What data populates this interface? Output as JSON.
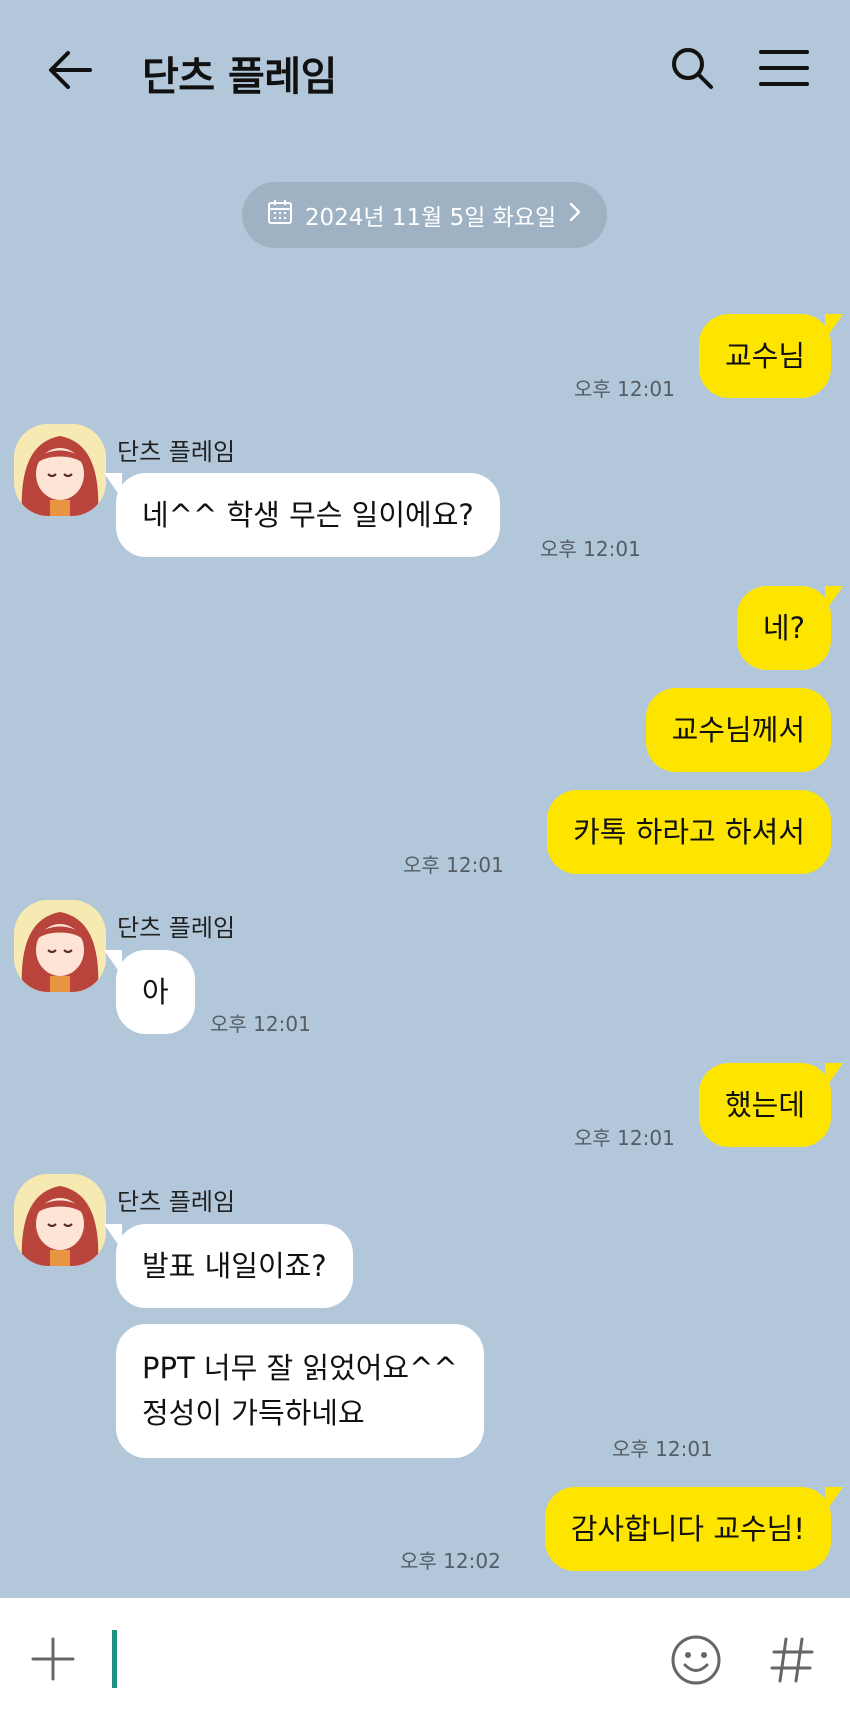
{
  "header": {
    "title": "단츠 플레임",
    "back_icon": "arrow-left-icon",
    "search_icon": "search-icon",
    "menu_icon": "hamburger-menu-icon"
  },
  "date_divider": {
    "text": "2024년 11월 5일 화요일",
    "icon": "calendar-icon",
    "chevron": "chevron-right-icon"
  },
  "contact": {
    "name": "단츠 플레임",
    "avatar": "anime-girl-avatar"
  },
  "messages": [
    {
      "from": "me",
      "text": "교수님",
      "time": "오후 12:01"
    },
    {
      "from": "other",
      "text": "네^^ 학생 무슨 일이에요?",
      "time": "오후 12:01"
    },
    {
      "from": "me",
      "text": "네?"
    },
    {
      "from": "me",
      "text": "교수님께서"
    },
    {
      "from": "me",
      "text": "카톡 하라고 하셔서",
      "time": "오후 12:01"
    },
    {
      "from": "other",
      "text": "아",
      "time": "오후 12:01"
    },
    {
      "from": "me",
      "text": "했는데",
      "time": "오후 12:01"
    },
    {
      "from": "other",
      "text": "발표 내일이죠?"
    },
    {
      "from": "other",
      "lines": [
        "PPT 너무 잘 읽었어요^^",
        "정성이 가득하네요"
      ],
      "time": "오후 12:01"
    },
    {
      "from": "me",
      "text": "감사합니다 교수님!",
      "time": "오후 12:02"
    }
  ],
  "input_bar": {
    "plus_icon": "plus-icon",
    "emoji_icon": "emoji-icon",
    "hash_icon": "hashtag-icon"
  },
  "colors": {
    "background": "#b2c7da",
    "my_bubble": "#fee500",
    "their_bubble": "#ffffff",
    "caret": "#1f8f7e"
  }
}
